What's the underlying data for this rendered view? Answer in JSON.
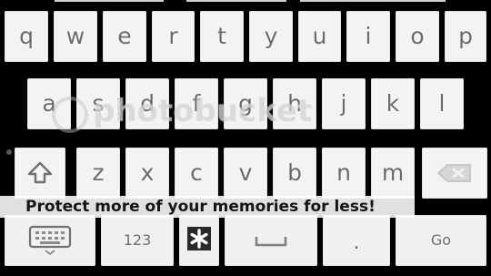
{
  "keyboard": {
    "row1": [
      "q",
      "w",
      "e",
      "r",
      "t",
      "y",
      "u",
      "i",
      "o",
      "p"
    ],
    "row2": [
      "a",
      "s",
      "d",
      "f",
      "g",
      "h",
      "j",
      "k",
      "l"
    ],
    "row3": [
      "z",
      "x",
      "c",
      "v",
      "b",
      "n",
      "m"
    ],
    "bottom": {
      "numbers_label": "123",
      "period_label": ".",
      "go_label": "Go"
    },
    "icons": {
      "shift": "shift-arrow-icon",
      "backspace": "backspace-icon",
      "keyboard": "keyboard-icon",
      "settings": "asterisk-icon",
      "space": "space-bar-icon"
    }
  },
  "watermark": {
    "text": "photobucket"
  },
  "banner": {
    "text": "Protect more of your memories for less!"
  }
}
